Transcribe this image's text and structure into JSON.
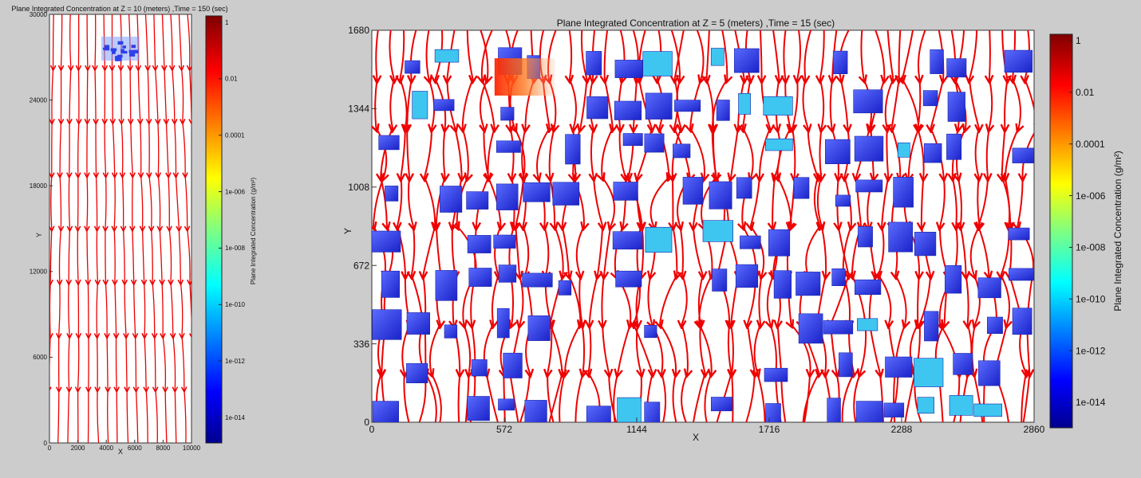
{
  "colors": {
    "background": "#cccccc",
    "plot_bg": "#ffffff",
    "streamline": "#ee0000",
    "building": "#2f3fe8",
    "building_dark": "#1a24a8"
  },
  "chart_data": [
    {
      "type": "heatmap",
      "title": "Plane Integrated Concentration at Z = 10 (meters) ,Time = 150 (sec)",
      "xlabel": "X",
      "ylabel": "Y",
      "xlim": [
        0,
        10000
      ],
      "ylim": [
        0,
        30000
      ],
      "xticks": [
        "0",
        "2000",
        "4000",
        "6000",
        "8000",
        "10000"
      ],
      "yticks": [
        "0",
        "6000",
        "12000",
        "18000",
        "24000",
        "30000"
      ],
      "xtick_values": [
        0,
        2000,
        4000,
        6000,
        8000,
        10000
      ],
      "ytick_values": [
        0,
        6000,
        12000,
        18000,
        24000,
        30000
      ],
      "colorbar": {
        "label": "Plane Integrated Concentration (g/m²)",
        "scale": "log",
        "ticks": [
          "1",
          "0.01",
          "0.0001",
          "1e-006",
          "1e-008",
          "1e-010",
          "1e-012",
          "1e-014"
        ]
      },
      "layers": [
        "concentration",
        "streamlines",
        "buildings"
      ],
      "wind_direction": "southward"
    },
    {
      "type": "heatmap",
      "title": "Plane Integrated Concentration at Z = 5 (meters) ,Time = 15 (sec)",
      "xlabel": "X",
      "ylabel": "Y",
      "xlim": [
        0,
        2860
      ],
      "ylim": [
        0,
        1680
      ],
      "xticks": [
        "0",
        "572",
        "1144",
        "1716",
        "2288",
        "2860"
      ],
      "yticks": [
        "0",
        "336",
        "672",
        "1008",
        "1344",
        "1680"
      ],
      "xtick_values": [
        0,
        572,
        1144,
        1716,
        2288,
        2860
      ],
      "ytick_values": [
        0,
        336,
        672,
        1008,
        1344,
        1680
      ],
      "colorbar": {
        "label": "Plane Integrated Concentration (g/m²)",
        "scale": "log",
        "ticks": [
          "1",
          "0.01",
          "0.0001",
          "1e-006",
          "1e-008",
          "1e-010",
          "1e-012",
          "1e-014"
        ]
      },
      "layers": [
        "concentration",
        "streamlines",
        "buildings"
      ],
      "wind_direction": "southward",
      "plume": {
        "x_range": [
          530,
          790
        ],
        "y_range": [
          1400,
          1560
        ],
        "peak": "0.01"
      }
    }
  ]
}
